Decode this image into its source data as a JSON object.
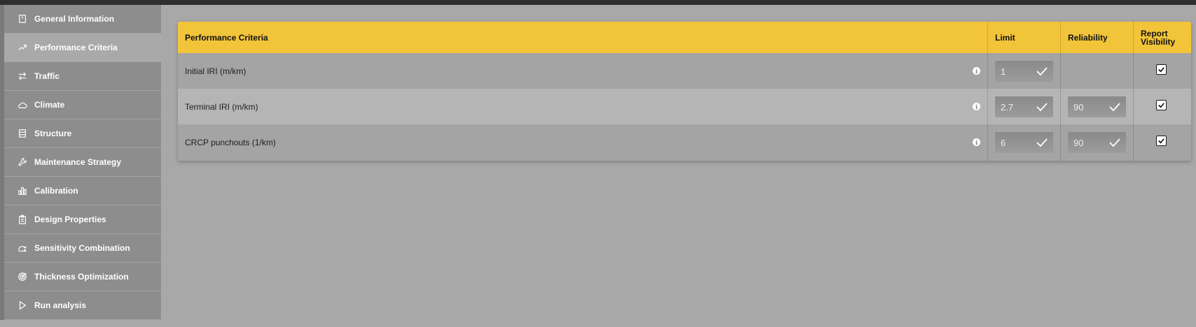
{
  "sidebar": {
    "items": [
      {
        "label": "General Information",
        "icon": "book-icon"
      },
      {
        "label": "Performance Criteria",
        "icon": "trending-up-icon",
        "active": true
      },
      {
        "label": "Traffic",
        "icon": "swap-arrows-icon"
      },
      {
        "label": "Climate",
        "icon": "cloud-sun-icon"
      },
      {
        "label": "Structure",
        "icon": "layers-icon"
      },
      {
        "label": "Maintenance Strategy",
        "icon": "wrench-icon"
      },
      {
        "label": "Calibration",
        "icon": "bar-chart-icon"
      },
      {
        "label": "Design Properties",
        "icon": "clipboard-icon"
      },
      {
        "label": "Sensitivity Combination",
        "icon": "sensitivity-icon"
      },
      {
        "label": "Thickness Optimization",
        "icon": "target-icon"
      },
      {
        "label": "Run analysis",
        "icon": "play-icon"
      }
    ]
  },
  "table": {
    "headers": {
      "criteria": "Performance Criteria",
      "limit": "Limit",
      "reliability": "Reliability",
      "report_line1": "Report",
      "report_line2": "Visibility"
    },
    "rows": [
      {
        "label": "Initial IRI (m/km)",
        "limit": "1",
        "reliability": "",
        "report_visible": true
      },
      {
        "label": "Terminal IRI (m/km)",
        "limit": "2.7",
        "reliability": "90",
        "report_visible": true
      },
      {
        "label": "CRCP punchouts (1/km)",
        "limit": "6",
        "reliability": "90",
        "report_visible": true
      }
    ]
  },
  "colors": {
    "header_bg": "#f2c43a",
    "sidebar_bg": "#8d8d8d",
    "sidebar_active_bg": "#a9a9a9",
    "page_bg": "#a8a8a8"
  }
}
